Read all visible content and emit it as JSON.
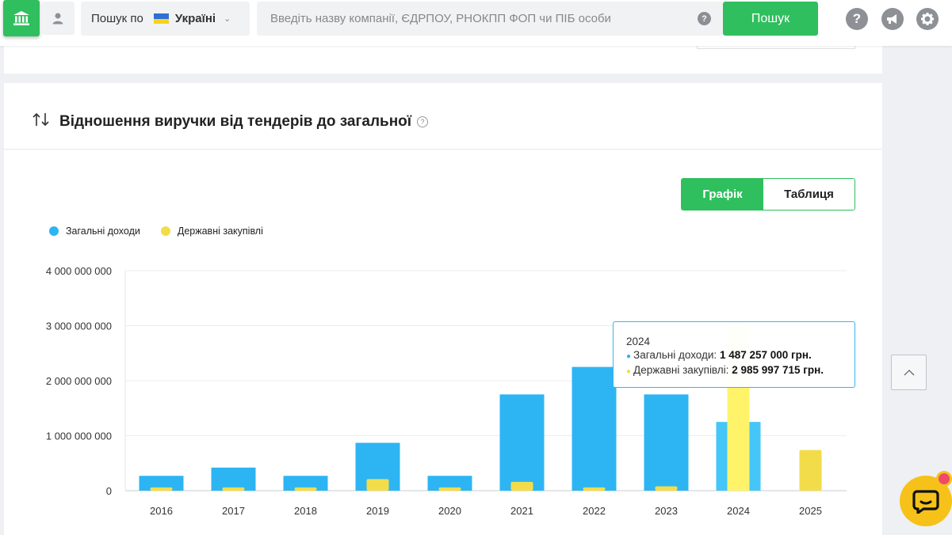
{
  "topbar": {
    "region_prefix": "Пошук по",
    "region_country": "Україні",
    "search_placeholder": "Введіть назву компанії, ЄДРПОУ, РНОКПП ФОП чи ПІБ особи",
    "search_button": "Пошук",
    "help_mark": "?",
    "icons": [
      "bank-icon",
      "user-icon",
      "help-icon",
      "megaphone-icon",
      "gear-icon"
    ]
  },
  "section": {
    "title": "Відношення виручки від тендерів до загальної",
    "view_toggle": {
      "chart": "Графік",
      "table": "Таблиця",
      "active": "chart"
    }
  },
  "legend": {
    "total": "Загальні доходи",
    "gov": "Державні закупівлі"
  },
  "colors": {
    "accent": "#2fbf5e",
    "total": "#2db5f3",
    "gov": "#f3dc4a",
    "gov_highlight": "#fff36a"
  },
  "chart_data": {
    "type": "bar",
    "categories": [
      "2016",
      "2017",
      "2018",
      "2019",
      "2020",
      "2021",
      "2022",
      "2023",
      "2024",
      "2025"
    ],
    "series": [
      {
        "name": "Загальні доходи",
        "values": [
          270000000,
          420000000,
          270000000,
          870000000,
          270000000,
          1750000000,
          2250000000,
          1750000000,
          1250000000,
          0
        ]
      },
      {
        "name": "Державні закупівлі",
        "values": [
          60000000,
          60000000,
          60000000,
          210000000,
          60000000,
          160000000,
          60000000,
          80000000,
          2985997715,
          740000000
        ]
      }
    ],
    "y_ticks": [
      "4 000 000 000",
      "3 000 000 000",
      "2 000 000 000",
      "1 000 000 000",
      "0"
    ],
    "ylim": [
      0,
      4000000000
    ],
    "grid": true,
    "legend_position": "top-left"
  },
  "tooltip": {
    "year": "2024",
    "total_label": "Загальні доходи:",
    "total_value": "1 487 257 000 грн.",
    "gov_label": "Державні закупівлі:",
    "gov_value": "2 985 997 715 грн."
  }
}
